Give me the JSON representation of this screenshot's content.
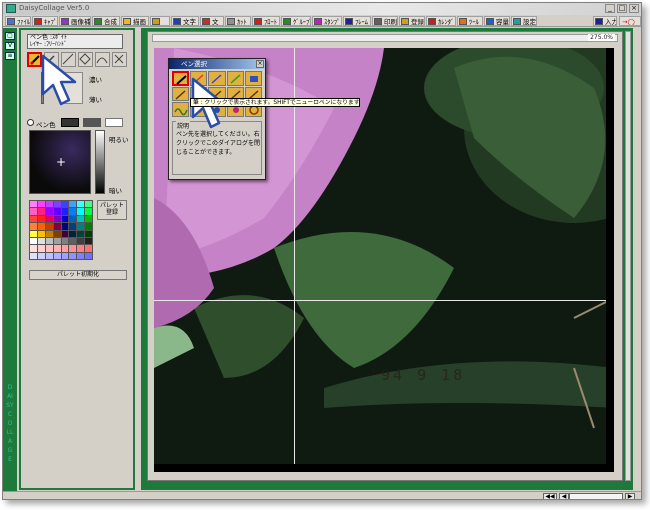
{
  "window": {
    "title": "DaisyCollage Ver5.0",
    "buttons": [
      "_",
      "□",
      "×"
    ]
  },
  "menu": [
    {
      "label": "ﾌｧｲﾙ",
      "icon": "file-icon",
      "color": "#4b6fd6"
    },
    {
      "label": "ｷｬﾌﾟ",
      "icon": "capture-icon",
      "color": "#d62020"
    },
    {
      "label": "画像補正",
      "icon": "adjust-icon",
      "color": "#8a3ac8"
    },
    {
      "label": "合成",
      "icon": "merge-icon",
      "color": "#2a8a2a"
    },
    {
      "label": "描画",
      "icon": "draw-icon",
      "color": "#e8b830"
    },
    {
      "label": "",
      "icon": "layer-icon",
      "color": "#c8a020"
    },
    {
      "label": "文字",
      "icon": "text-icon",
      "color": "#2040c0"
    },
    {
      "label": "文",
      "icon": "text2-icon",
      "color": "#c03030"
    },
    {
      "label": "ｶｯﾄ",
      "icon": "cut-icon",
      "color": "#909090"
    },
    {
      "label": "ﾌﾛｰﾄ",
      "icon": "float-icon",
      "color": "#d02020"
    },
    {
      "label": "ｸﾞﾙｰﾌﾟ",
      "icon": "group-icon",
      "color": "#209020"
    },
    {
      "label": "ｽﾀﾝﾌﾟ",
      "icon": "stamp-icon",
      "color": "#c020c0"
    },
    {
      "label": "ﾌﾚｰﾑ",
      "icon": "frame-icon",
      "color": "#2020a0"
    },
    {
      "label": "印刷",
      "icon": "print-icon",
      "color": "#606060"
    },
    {
      "label": "登録",
      "icon": "register-icon",
      "color": "#d0a020"
    },
    {
      "label": "ｶﾚﾝﾀﾞ",
      "icon": "calendar-icon",
      "color": "#c02020"
    },
    {
      "label": "ﾂｰﾙ",
      "icon": "tool-icon",
      "color": "#e07020"
    },
    {
      "label": "容量",
      "icon": "capacity-icon",
      "color": "#2060c0"
    },
    {
      "label": "設定",
      "icon": "settings-icon",
      "color": "#20a0a0"
    },
    {
      "label": "入力",
      "icon": "input-icon",
      "color": "#2020a0"
    }
  ],
  "left_strip": {
    "buttons": [
      "▢",
      "V",
      "≡"
    ],
    "vertical_text": "DAISY COLLAGE"
  },
  "panel": {
    "mode_line1": "ペン色",
    "mode_line2": "ﾚｲﾔｰ",
    "mode_val1": ":ｽﾎﾟｲﾄ",
    "mode_val2": ":ﾌﾘｰﾊﾝﾄﾞ",
    "label_thick": "濃い",
    "label_thin": "薄い",
    "label_pen_color": "ペン色",
    "label_bright": "明るい",
    "label_dark": "暗い",
    "register_line1": "パレット",
    "register_line2": "登録",
    "init_button": "パレット初期化"
  },
  "palette_colors": [
    "#ff80ff",
    "#ff40ff",
    "#c040ff",
    "#8040ff",
    "#4040ff",
    "#40a0ff",
    "#40ffff",
    "#40ff80",
    "#ff60c0",
    "#ff2080",
    "#a000ff",
    "#6000ff",
    "#2020ff",
    "#0080ff",
    "#00ffff",
    "#00ff40",
    "#ff4040",
    "#ff2020",
    "#e00060",
    "#8000c0",
    "#0000c0",
    "#0060c0",
    "#00c0c0",
    "#00c000",
    "#ff8040",
    "#ff6000",
    "#c04000",
    "#800040",
    "#000080",
    "#004080",
    "#008080",
    "#008000",
    "#ffff40",
    "#ffc000",
    "#c08000",
    "#804000",
    "#400040",
    "#002040",
    "#004040",
    "#004000",
    "#ffffff",
    "#e0e0e0",
    "#c0c0c0",
    "#a0a0a0",
    "#808080",
    "#606060",
    "#404040",
    "#202020",
    "#ffe0e0",
    "#ffd0d0",
    "#ffc0c0",
    "#ffb0b0",
    "#ffa0a0",
    "#ff9090",
    "#ff8080",
    "#ff7070",
    "#e0e0ff",
    "#d0d0ff",
    "#c0c0ff",
    "#b0b0ff",
    "#a0a0ff",
    "#9090ff",
    "#8080ff",
    "#7070ff"
  ],
  "canvas": {
    "zoom": "275.0%",
    "timestamp": "'94  9 18"
  },
  "pen_dialog": {
    "title": "ペン選択",
    "close": "×",
    "group_label": "説明",
    "description": "ペン先を選択してください。右クリックでこのダイアログを閉じることができます。",
    "tooltip": "筆 : クリックで表示されます。SHIFTでニューロペンになります。"
  },
  "statusbar": {
    "nav_first": "◀◀",
    "nav_prev": "◀",
    "nav_next": "▶"
  },
  "colors": {
    "frame_green": "#1d7a3a",
    "highlight_red": "#e00000",
    "tool_gold": "#e8b830"
  }
}
